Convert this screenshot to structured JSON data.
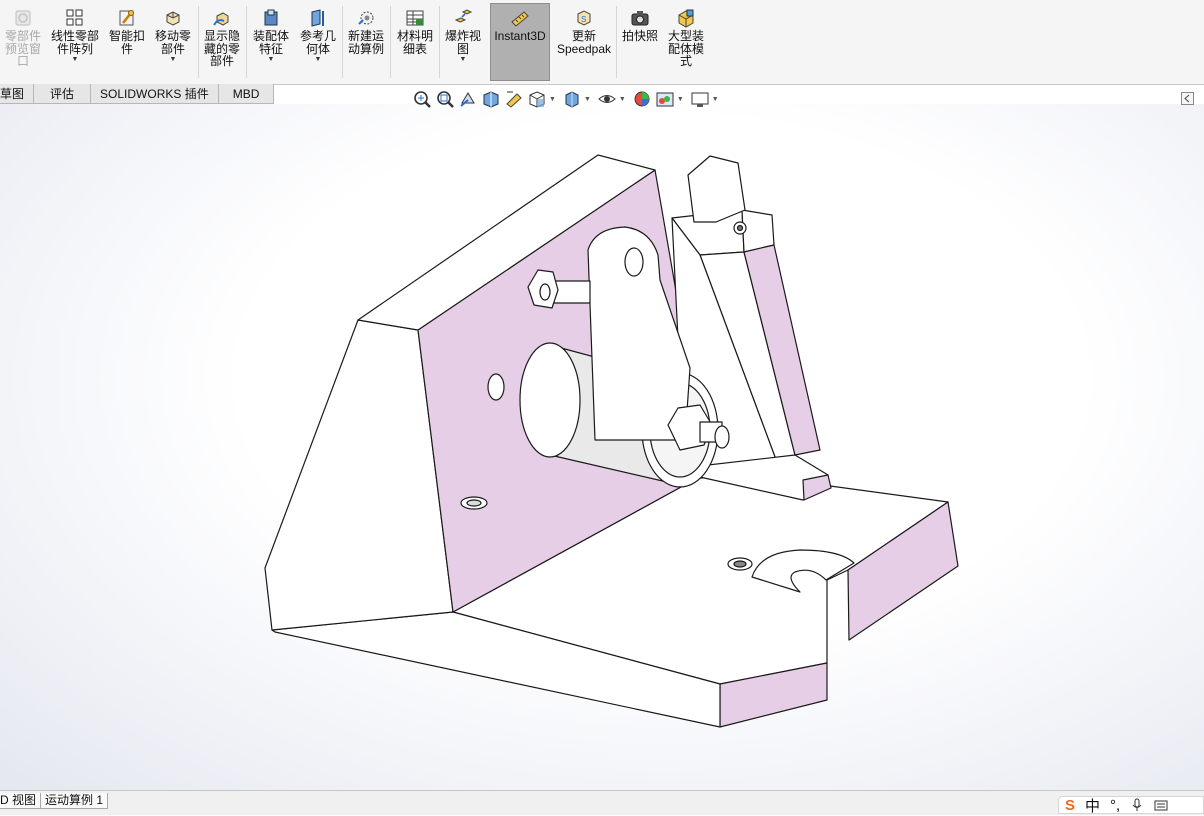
{
  "ribbon": {
    "buttons": [
      {
        "id": "preview",
        "label": "零部件\n预览窗\n口",
        "disabled": true,
        "caret": false
      },
      {
        "id": "linear-pattern",
        "label": "线性零部\n件阵列",
        "disabled": false,
        "caret": true
      },
      {
        "id": "smart-fastener",
        "label": "智能扣\n件",
        "disabled": false,
        "caret": false
      },
      {
        "id": "move-component",
        "label": "移动零\n部件",
        "disabled": false,
        "caret": true
      },
      {
        "id": "show-hidden",
        "label": "显示隐\n藏的零\n部件",
        "disabled": false,
        "caret": false
      },
      {
        "id": "assembly-feature",
        "label": "装配体\n特征",
        "disabled": false,
        "caret": true
      },
      {
        "id": "reference-geometry",
        "label": "参考几\n何体",
        "disabled": false,
        "caret": true
      },
      {
        "id": "new-motion-study",
        "label": "新建运\n动算例",
        "disabled": false,
        "caret": false
      },
      {
        "id": "bom",
        "label": "材料明\n细表",
        "disabled": false,
        "caret": false
      },
      {
        "id": "exploded-view",
        "label": "爆炸视\n图",
        "disabled": false,
        "caret": true
      },
      {
        "id": "instant3d",
        "label": "Instant3D",
        "disabled": false,
        "caret": false,
        "active": true
      },
      {
        "id": "update-speedpak",
        "label": "更新\nSpeedpak",
        "disabled": false,
        "caret": false
      },
      {
        "id": "snapshot",
        "label": "拍快照",
        "disabled": false,
        "caret": false
      },
      {
        "id": "large-assembly",
        "label": "大型装\n配体模\n式",
        "disabled": false,
        "caret": false
      }
    ]
  },
  "tabs": [
    "草图",
    "评估",
    "SOLIDWORKS 插件",
    "MBD"
  ],
  "bottom_tabs": [
    "D 视图",
    "运动算例 1"
  ],
  "ime": {
    "logo": "S",
    "lang": "中"
  },
  "colors": {
    "face_pink": "#e6cfe6",
    "face_white": "#ffffff",
    "edge": "#1a1a1a",
    "ribbon_bg": "#f5f5f5",
    "active_btn": "#b0b0b0"
  }
}
